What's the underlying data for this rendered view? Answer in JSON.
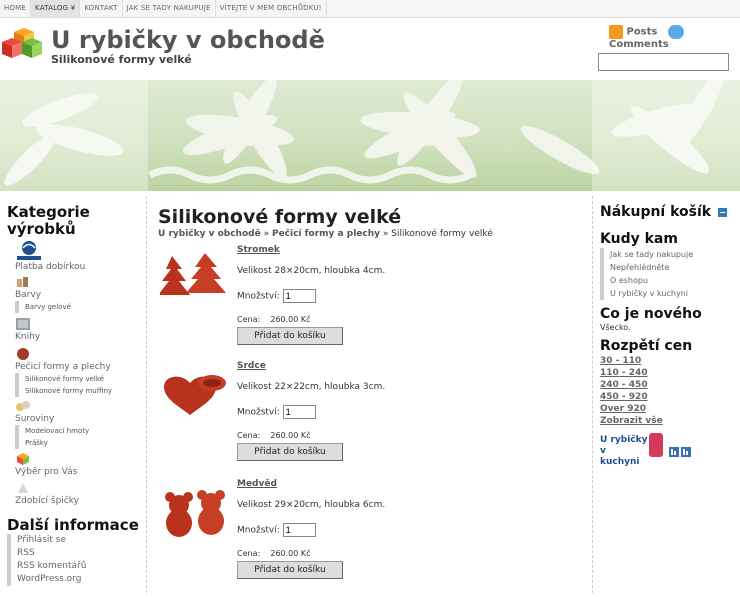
{
  "nav": [
    "HOME",
    "KATALOG ¥",
    "KONTAKT",
    "JAK SE TADY NAKUPUJE",
    "VÍTEJTE V MÉM OBCHŮDKU!"
  ],
  "header": {
    "title": "U rybičky v obchodě",
    "subtitle": "Silikonové formy velké",
    "posts": "Posts",
    "comments": "Comments",
    "search_value": ""
  },
  "left": {
    "categories_title": "Kategorie výrobků",
    "categories": [
      {
        "label": "Platba dobírkou",
        "icon": "ceska-posta-logo",
        "subs": []
      },
      {
        "label": "Barvy",
        "icon": "paint-icon",
        "subs": [
          "Barvy gelové"
        ]
      },
      {
        "label": "Knihy",
        "icon": "book-icon",
        "subs": []
      },
      {
        "label": "Pečicí formy a plechy",
        "icon": "baking-icon",
        "subs": [
          "Silikonové formy velké",
          "Silikonové formy muffiny"
        ]
      },
      {
        "label": "Suroviny",
        "icon": "ingredients-icon",
        "subs": [
          "Modelovací hmoty",
          "Prášky"
        ]
      },
      {
        "label": "Výběr pro Vás",
        "icon": "gift-icon",
        "subs": []
      },
      {
        "label": "Zdobící špičky",
        "icon": "piping-tip-icon",
        "subs": []
      }
    ],
    "info_title": "Další informace",
    "info_items": [
      "Přihlásit se",
      "RSS",
      "RSS komentářů",
      "WordPress.org"
    ]
  },
  "main": {
    "title": "Silikonové formy velké",
    "crumb_1": "U rybičky v obchodě",
    "crumb_sep": "»",
    "crumb_2": "Pečicí formy a plechy",
    "crumb_3": "Silikonové formy velké",
    "qty_label": "Množství:",
    "price_label": "Cena:",
    "btn_label": "Přidat do košíku",
    "products": [
      {
        "name": "Stromek",
        "desc": "Velikost 28×20cm, hloubka 4cm.",
        "qty": "1",
        "price": "260.00 Kč"
      },
      {
        "name": "Srdce",
        "desc": "Velikost 22×22cm, hloubka 3cm.",
        "qty": "1",
        "price": "260.00 Kč"
      },
      {
        "name": "Medvěd",
        "desc": "Velikost 29×20cm, hloubka 6cm.",
        "qty": "1",
        "price": "260.00 Kč"
      }
    ]
  },
  "right": {
    "cart_title": "Nákupní košík",
    "kudy_title": "Kudy kam",
    "kudy_items": [
      "Jak se tady nakupuje",
      "Nepřehlédněte",
      "O eshopu",
      "U rybičky v kuchyni"
    ],
    "new_title": "Co je nového",
    "new_text": "Všecko.",
    "price_title": "Rozpětí cen",
    "price_ranges": [
      "30 - 110",
      "110 - 240",
      "240 - 450",
      "450 - 920",
      "Over 920",
      "Zobrazit vše"
    ],
    "kitchen_link": "U rybičky v kuchyni"
  },
  "colors": {
    "accent": "#2d7bb8",
    "banner_green": "#cfe0bc",
    "product_red": "#b8321e"
  }
}
